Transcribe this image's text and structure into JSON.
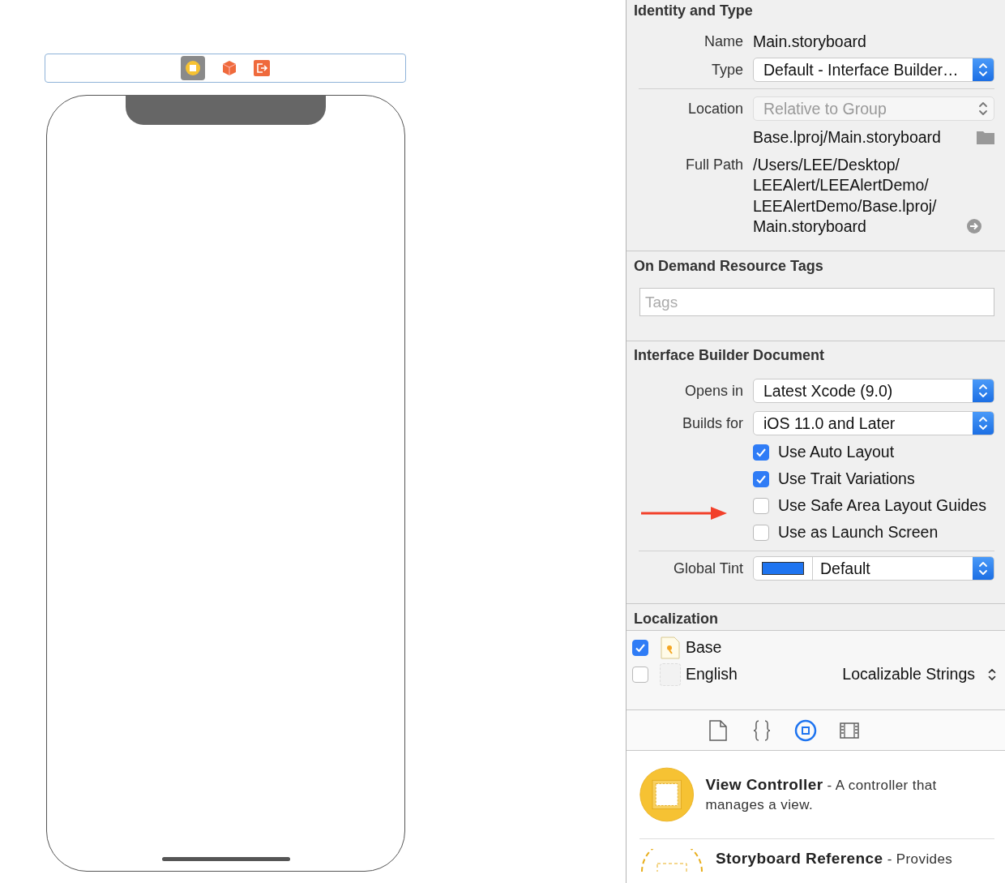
{
  "identity": {
    "title": "Identity and Type",
    "name_label": "Name",
    "name": "Main.storyboard",
    "type_label": "Type",
    "type": "Default - Interface Builder…",
    "location_label": "Location",
    "location": "Relative to Group",
    "relative_path": "Base.lproj/Main.storyboard",
    "full_path_label": "Full Path",
    "full_path_lines": [
      "/Users/LEE/Desktop/",
      "LEEAlert/LEEAlertDemo/",
      "LEEAlertDemo/Base.lproj/",
      "Main.storyboard"
    ]
  },
  "resource_tags": {
    "title": "On Demand Resource Tags",
    "placeholder": "Tags"
  },
  "ib_document": {
    "title": "Interface Builder Document",
    "opens_in_label": "Opens in",
    "opens_in": "Latest Xcode (9.0)",
    "builds_for_label": "Builds for",
    "builds_for": "iOS 11.0 and Later",
    "options": [
      {
        "label": "Use Auto Layout",
        "checked": true
      },
      {
        "label": "Use Trait Variations",
        "checked": true
      },
      {
        "label": "Use Safe Area Layout Guides",
        "checked": false
      },
      {
        "label": "Use as Launch Screen",
        "checked": false
      }
    ],
    "global_tint_label": "Global Tint",
    "global_tint": {
      "label": "Default",
      "color": "#1e74f0"
    }
  },
  "localization": {
    "title": "Localization",
    "items": [
      {
        "name": "Base",
        "checked": true,
        "kind": "file"
      },
      {
        "name": "English",
        "checked": false,
        "kind": "empty",
        "file_type": "Localizable Strings"
      }
    ]
  },
  "library_tabs": [
    {
      "kind": "file",
      "selected": false
    },
    {
      "kind": "braces",
      "selected": false
    },
    {
      "kind": "object",
      "selected": true
    },
    {
      "kind": "media",
      "selected": false
    }
  ],
  "library_items": [
    {
      "kind": "controller",
      "title": "View Controller",
      "description": "- A controller that manages a view."
    },
    {
      "kind": "reference",
      "title": "Storyboard Reference",
      "description": "- Provides"
    }
  ]
}
